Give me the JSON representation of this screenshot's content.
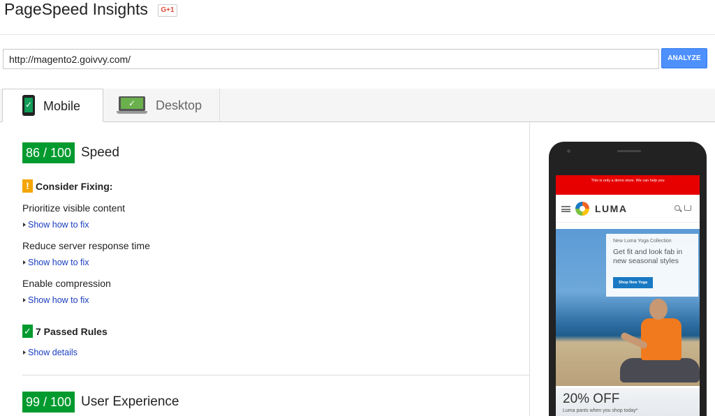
{
  "header": {
    "title": "PageSpeed Insights",
    "gplus_label": "G+1"
  },
  "url_bar": {
    "value": "http://magento2.goivvy.com/",
    "analyze_label": "ANALYZE"
  },
  "tabs": [
    {
      "label": "Mobile",
      "active": true
    },
    {
      "label": "Desktop",
      "active": false
    }
  ],
  "speed": {
    "score": "86 / 100",
    "label": "Speed",
    "consider_heading": "Consider Fixing:",
    "rules": [
      {
        "name": "Prioritize visible content",
        "link": "Show how to fix"
      },
      {
        "name": "Reduce server response time",
        "link": "Show how to fix"
      },
      {
        "name": "Enable compression",
        "link": "Show how to fix"
      }
    ],
    "passed_heading": "7 Passed Rules",
    "passed_link": "Show details"
  },
  "ux": {
    "score": "99 / 100",
    "label": "User Experience"
  },
  "preview": {
    "demo_notice": "This is only a demo store. We can help you",
    "logo": "LUMA",
    "promo_kicker": "New Luma Yoga Collection",
    "promo_headline": "Get fit and look fab in new seasonal styles",
    "shop_button": "Shop New Yoga",
    "sale_title": "20% OFF",
    "sale_sub": "Luma pants when you shop today*"
  },
  "colors": {
    "score_green": "#009a2e",
    "warning_orange": "#f4a500",
    "link_blue": "#1a3dc1",
    "analyze_blue": "#4d90fe"
  }
}
